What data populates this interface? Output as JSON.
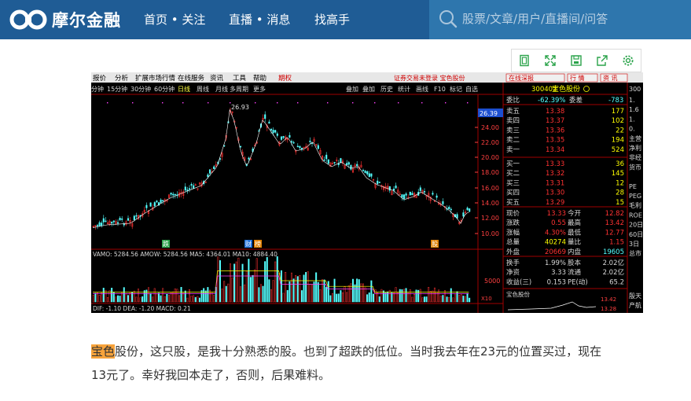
{
  "header": {
    "logo_text": "摩尔金融",
    "nav": [
      "首页 • 关注",
      "直播 • 消息",
      "找高手"
    ],
    "search_placeholder": "股票/文章/用户/直播间/问答"
  },
  "toolbar": {
    "icons": [
      "page-icon",
      "expand-icon",
      "save-icon",
      "share-icon",
      "settings-icon"
    ]
  },
  "stock_screenshot": {
    "menu": [
      "报价",
      "分析",
      "扩展市场行情",
      "在线服务",
      "资讯",
      "工具",
      "帮助"
    ],
    "menu_tag": "期权",
    "menu_right": "证券交易未登录  宝色股份",
    "periods": [
      "分钟",
      "15分钟",
      "30分钟",
      "60分钟",
      "日线",
      "周线",
      "月线",
      "多周期",
      "更多"
    ],
    "period_right": [
      "叠加",
      "叠加",
      "历史",
      "统计",
      "画线",
      "F10",
      "标记",
      "自选"
    ],
    "peak_label": "26.93",
    "axis_labels": [
      "24.00",
      "22.00",
      "20.00",
      "18.00",
      "16.00",
      "14.00",
      "12.00",
      "10.00"
    ],
    "last_price_tag": "26.39",
    "event_tags": [
      "跌",
      "财",
      "榜",
      "股"
    ],
    "vol_legend": "VAMO: 5284.56  AMOW: 5284.56  MA5: 4364.01  MA10: 4884.40",
    "vol_axis": [
      "5000"
    ],
    "vol_unit": "X10",
    "macd_legend": "DIF: -1.10  DEA: -1.20  MACD: 0.21",
    "right_btns": [
      "在线深报",
      "行 情",
      "资 讯"
    ],
    "quote": {
      "code": "300402",
      "name": "宝色股份",
      "webi_label": "委比",
      "webi": "-62.39%",
      "weicha_label": "委差",
      "weicha": "-783",
      "asks": [
        {
          "label": "卖五",
          "price": "13.38",
          "vol": "177"
        },
        {
          "label": "卖四",
          "price": "13.37",
          "vol": "102"
        },
        {
          "label": "卖三",
          "price": "13.36",
          "vol": "22"
        },
        {
          "label": "卖二",
          "price": "13.35",
          "vol": "194"
        },
        {
          "label": "卖一",
          "price": "13.34",
          "vol": "524"
        }
      ],
      "bids": [
        {
          "label": "买一",
          "price": "13.33",
          "vol": "36"
        },
        {
          "label": "买二",
          "price": "13.32",
          "vol": "145"
        },
        {
          "label": "买三",
          "price": "13.31",
          "vol": "12"
        },
        {
          "label": "买四",
          "price": "13.30",
          "vol": "28"
        },
        {
          "label": "买五",
          "price": "13.29",
          "vol": "15"
        }
      ],
      "stats": [
        {
          "l1": "现价",
          "v1": "13.33",
          "l2": "今开",
          "v2": "12.82"
        },
        {
          "l1": "涨跌",
          "v1": "0.55",
          "l2": "最高",
          "v2": "13.42"
        },
        {
          "l1": "涨幅",
          "v1": "4.30%",
          "l2": "最低",
          "v2": "12.77"
        },
        {
          "l1": "总量",
          "v1": "40274",
          "l2": "量比",
          "v2": "1.15"
        },
        {
          "l1": "外盘",
          "v1": "20669",
          "l2": "内盘",
          "v2": "19605"
        }
      ],
      "stats2": [
        {
          "l1": "换手",
          "v1": "1.99%",
          "l2": "股本",
          "v2": "2.02亿"
        },
        {
          "l1": "净资",
          "v1": "3.33",
          "l2": "流通",
          "v2": "2.02亿"
        },
        {
          "l1": "收益(三)",
          "v1": "0.153",
          "l2": "PE(动)",
          "v2": "65.2"
        }
      ],
      "mini_title": "宝色股份",
      "mini_high": "13.42",
      "mini_low": "13.28"
    },
    "far_right_code": "300",
    "far_right": [
      "1.",
      "1.6",
      "1.",
      "0.",
      "主营",
      "净利",
      "非经",
      "货币",
      "",
      "PE",
      "PEG",
      "毛利",
      "ROE",
      "20日",
      "60日",
      "3日",
      "总市"
    ],
    "far_right_bottom": [
      "殷天",
      "产航"
    ]
  },
  "article": {
    "highlight": "宝色",
    "line1": "股份，这只股，是我十分熟悉的股。也到了超跌的低位。当时我去年在23元的位置买过，现在",
    "line2": "13元了。幸好我回本走了，否则，后果难料。"
  },
  "colors": {
    "header_bg": "#1f5c95",
    "search_bg": "#2e76ad",
    "up": "#ff3232",
    "down": "#54ffff",
    "highlight": "#f7a33b"
  }
}
